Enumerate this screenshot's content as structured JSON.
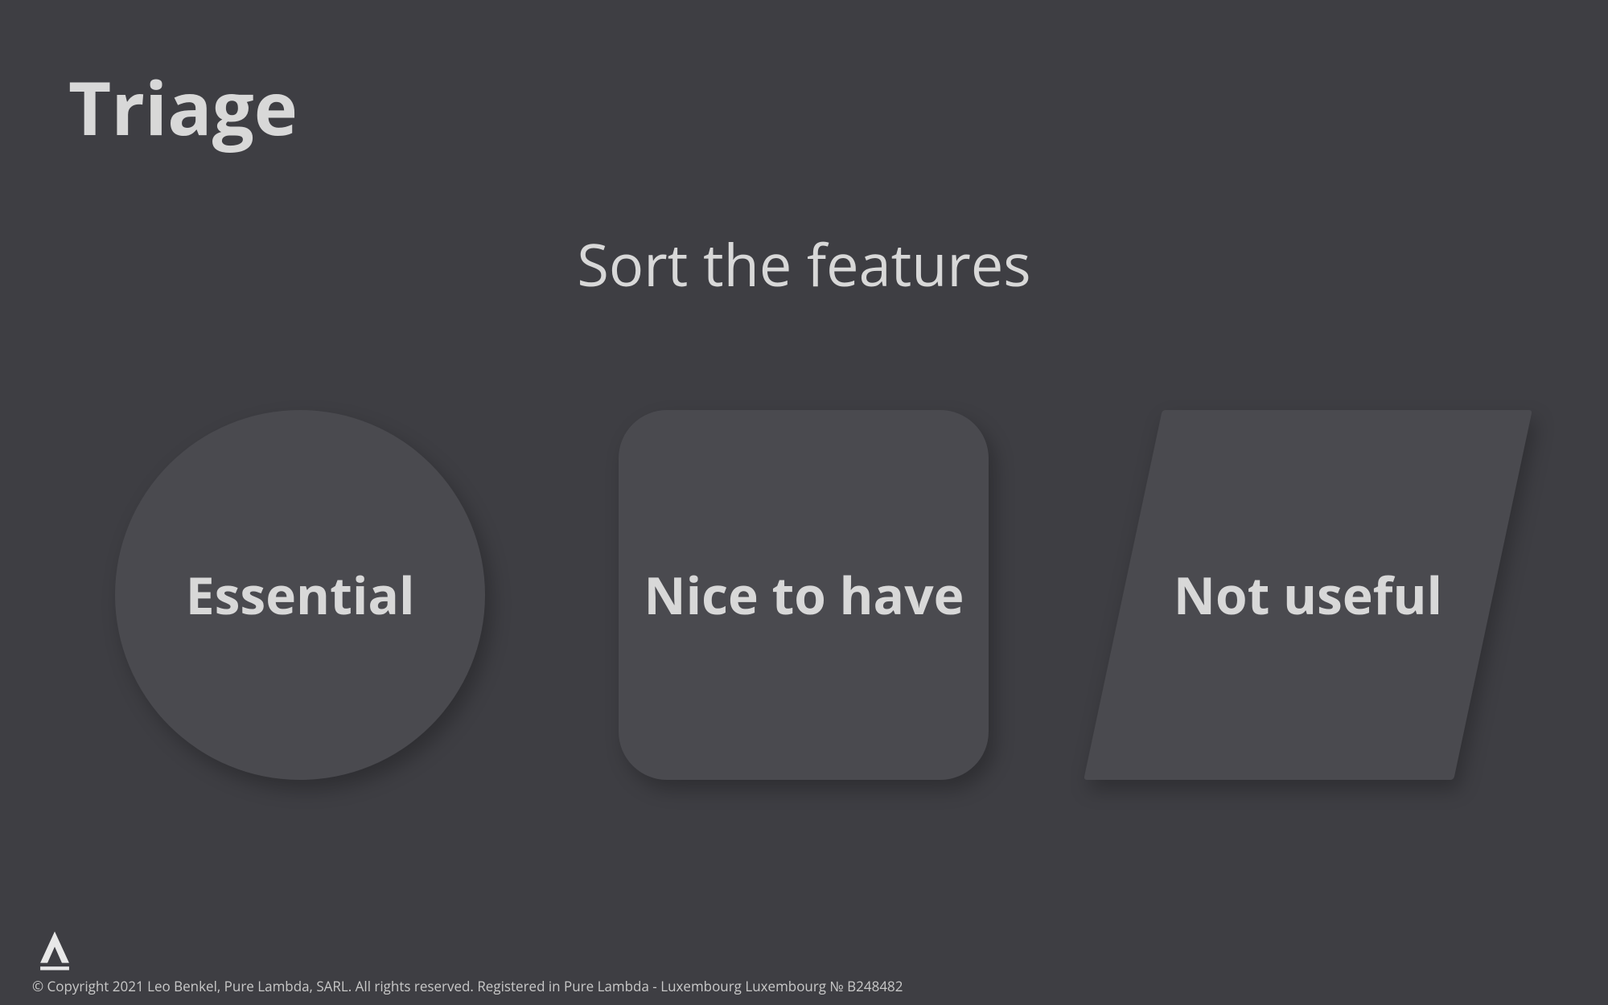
{
  "title": "Triage",
  "subtitle": "Sort the features",
  "categories": {
    "essential": "Essential",
    "nice_to_have": "Nice to have",
    "not_useful": "Not useful"
  },
  "footer": {
    "copyright": "© Copyright 2021 Leo Benkel, Pure Lambda, SARL. All rights reserved. Registered in Pure Lambda - Luxembourg Luxembourg № B248482"
  }
}
